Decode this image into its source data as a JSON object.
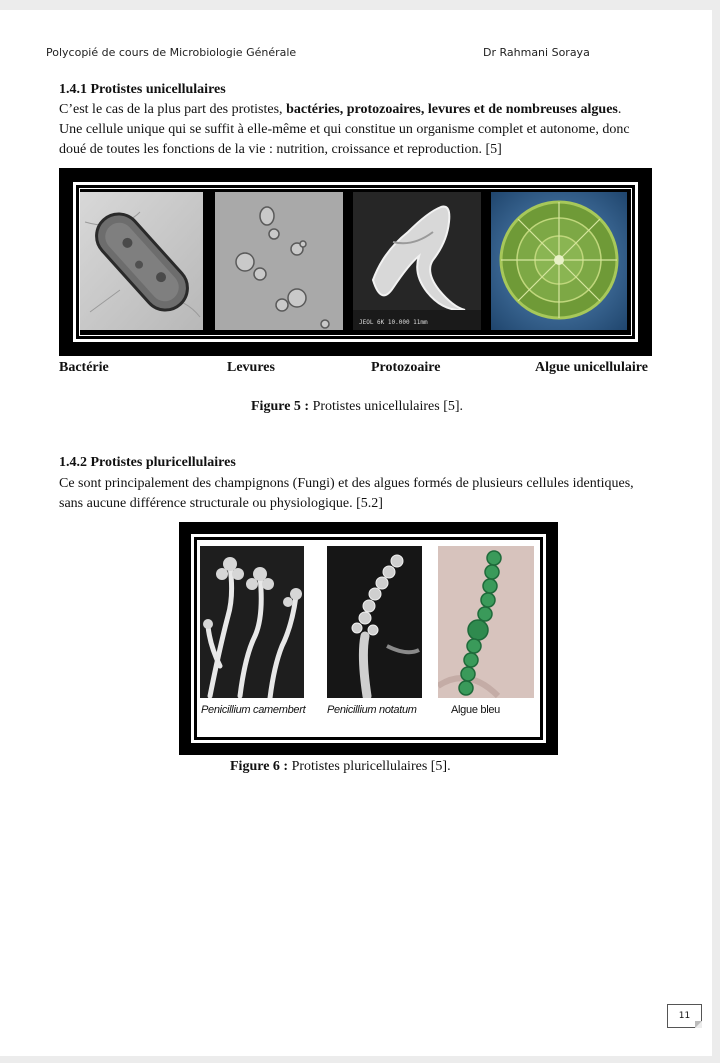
{
  "header": {
    "left": "Polycopié de cours de Microbiologie Générale",
    "right": "Dr Rahmani Soraya"
  },
  "section_1": {
    "heading": "1.4.1 Protistes unicellulaires",
    "p1_before": "C’est le cas de la plus part des protistes, ",
    "p1_bold": "bactéries, protozoaires, levures et de nombreuses algues",
    "p1_after": ".",
    "p2": "Une cellule unique qui se suffit à elle-même et qui constitue un organisme complet et autonome, donc doué de toutes les fonctions de la vie : nutrition, croissance et reproduction. [5]"
  },
  "figure5": {
    "captions": [
      "Bactérie",
      "Levures",
      "Protozoaire",
      "Algue unicellulaire"
    ],
    "micrograph_text": "JEOL  6K  10.000  11mm",
    "label": "Figure 5 :",
    "title": " Protistes unicellulaires [5]."
  },
  "section_2": {
    "heading": "1.4.2 Protistes pluricellulaires",
    "paragraph": "Ce sont principalement des champignons (Fungi) et des algues formés de plusieurs cellules identiques, sans aucune différence structurale ou physiologique. [5.2]"
  },
  "figure6": {
    "captions": [
      "Penicillium camembert",
      "Penicillium notatum",
      "Algue bleu"
    ],
    "label": "Figure 6 :",
    "title": " Protistes pluricellulaires [5]."
  },
  "page_number": "11"
}
